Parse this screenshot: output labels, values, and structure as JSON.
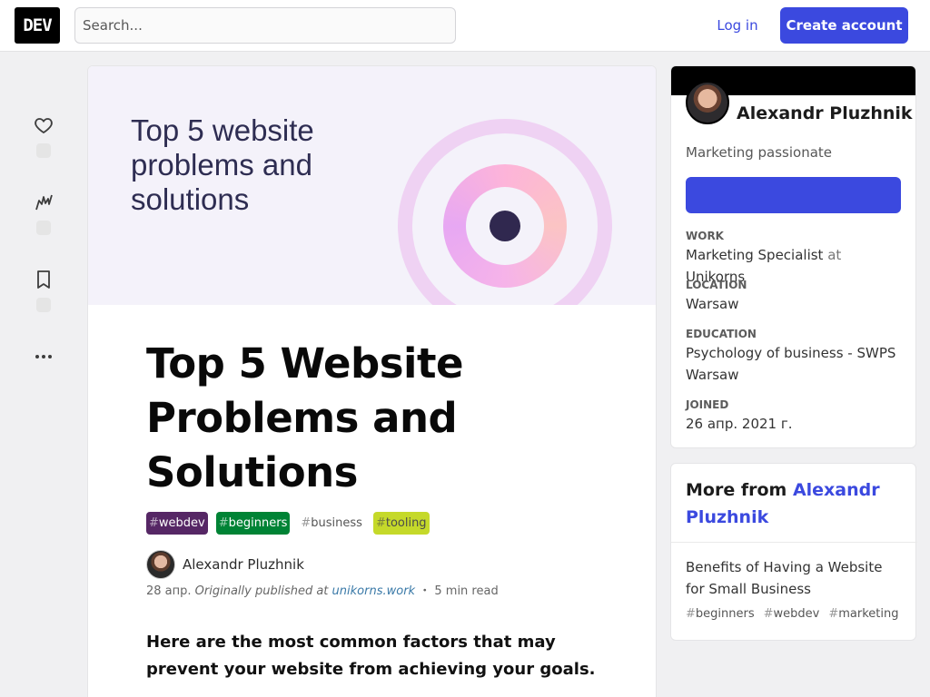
{
  "header": {
    "logo": "DEV",
    "search_placeholder": "Search...",
    "login_label": "Log in",
    "create_account_label": "Create account"
  },
  "rail": {
    "heart_icon": "heart-icon",
    "unicorn_icon": "unicorn-icon",
    "bookmark_icon": "bookmark-icon",
    "more_icon": "more-icon"
  },
  "article": {
    "cover_title": "Top 5 website problems and solutions",
    "title": "Top 5 Website Problems and Solutions",
    "tags": [
      {
        "hash": "#",
        "name": "webdev"
      },
      {
        "hash": "#",
        "name": "beginners"
      },
      {
        "hash": "#",
        "name": "business"
      },
      {
        "hash": "#",
        "name": "tooling"
      }
    ],
    "author": "Alexandr Pluzhnik",
    "date": "28 апр.",
    "originally": "Originally published at",
    "source": "unikorns.work",
    "separator": "・",
    "read_time": "5 min read",
    "lead": "Here are the most common factors that may prevent your website from achieving your goals."
  },
  "profile": {
    "name": "Alexandr Pluzhnik",
    "summary": "Marketing passionate",
    "work_label": "WORK",
    "work_title": "Marketing Specialist",
    "work_at": "at",
    "work_company": "Unikorns",
    "location_label": "LOCATION",
    "location": "Warsaw",
    "education_label": "EDUCATION",
    "education": "Psychology of business - SWPS Warsaw",
    "joined_label": "JOINED",
    "joined": "26 апр. 2021 г."
  },
  "more": {
    "heading_prefix": "More from",
    "heading_name": "Alexandr Pluzhnik",
    "post_title": "Benefits of Having a Website for Small Business",
    "post_tags": [
      {
        "hash": "#",
        "name": "beginners"
      },
      {
        "hash": "#",
        "name": "webdev"
      },
      {
        "hash": "#",
        "name": "marketing"
      }
    ]
  },
  "colors": {
    "accent": "#3b49df",
    "tag_webdev": "#562765",
    "tag_beginners": "#008335",
    "tag_tooling": "#c5d92a"
  }
}
